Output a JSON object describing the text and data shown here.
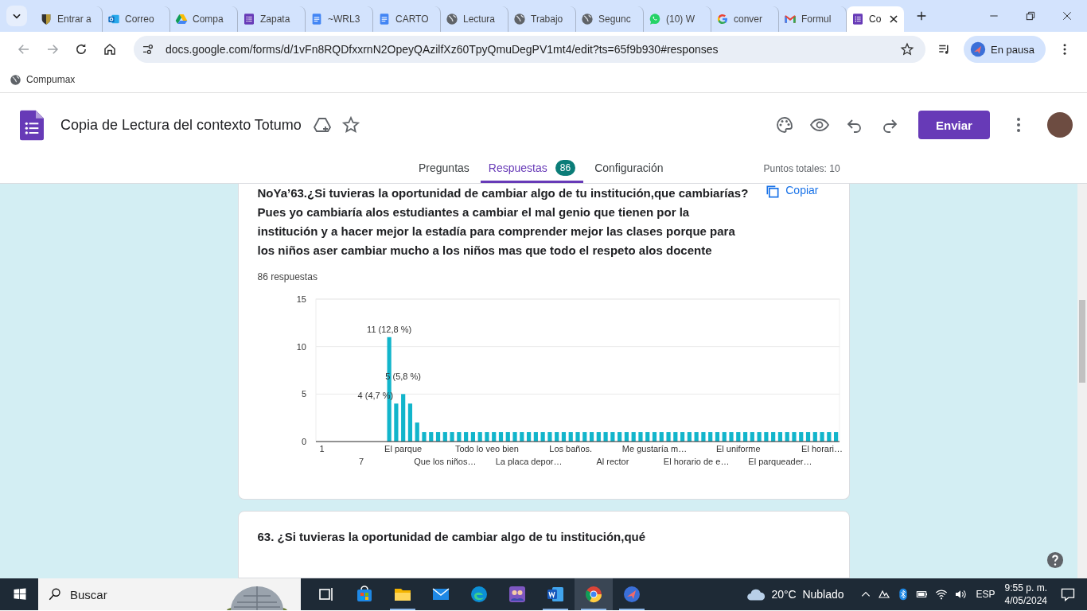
{
  "browser": {
    "tabs": [
      {
        "title": "Entrar a",
        "kind": "shield",
        "selected": false
      },
      {
        "title": "Correo",
        "kind": "outlook",
        "selected": false
      },
      {
        "title": "Compa",
        "kind": "drive",
        "selected": false
      },
      {
        "title": "Zapata",
        "kind": "forms",
        "selected": false
      },
      {
        "title": "~WRL3",
        "kind": "docs",
        "selected": false
      },
      {
        "title": "CARTO",
        "kind": "docs",
        "selected": false
      },
      {
        "title": "Lectura",
        "kind": "globe",
        "selected": false
      },
      {
        "title": "Trabajo",
        "kind": "globe",
        "selected": false
      },
      {
        "title": "Segunc",
        "kind": "globe",
        "selected": false
      },
      {
        "title": "(10) W",
        "kind": "whatsapp",
        "selected": false
      },
      {
        "title": "conver",
        "kind": "google",
        "selected": false
      },
      {
        "title": "Formul",
        "kind": "gmail",
        "selected": false
      },
      {
        "title": "Co",
        "kind": "forms",
        "selected": true
      }
    ],
    "address": "docs.google.com/forms/d/1vFn8RQDfxxrnN2OpeyQAzilfXz60TpyQmuDegPV1mt4/edit?ts=65f9b930#responses",
    "profile": "En pausa",
    "bookmarks": [
      "Compumax"
    ]
  },
  "form": {
    "title": "Copia de Lectura del contexto Totumo",
    "send_button": "Enviar",
    "tabs": [
      {
        "label": "Preguntas",
        "selected": false
      },
      {
        "label": "Respuestas",
        "badge": "86",
        "selected": true
      },
      {
        "label": "Configuración",
        "selected": false
      }
    ],
    "points": "Puntos totales: 10"
  },
  "questions": [
    {
      "text": "NoYa’63.¿Si tuvieras la oportunidad de cambiar algo de tu institución,que cambiarías? Pues yo cambiaría alos estudiantes a cambiar el mal genio que tienen por la institución y a hacer mejor la estadía para comprender mejor las clases porque para los niños aser cambiar mucho a los niños mas que todo el respeto alos docente",
      "copy_button": "Copiar",
      "response_count": "86 respuestas",
      "chart_data": {
        "type": "bar",
        "ylim": [
          0,
          15
        ],
        "yticks": [
          0,
          5,
          10,
          15
        ],
        "values": [
          0,
          0,
          0,
          0,
          0,
          0,
          0,
          0,
          0,
          0,
          11,
          4,
          5,
          4,
          2,
          1,
          1,
          1,
          1,
          1,
          1,
          1,
          1,
          1,
          1,
          1,
          1,
          1,
          1,
          1,
          1,
          1,
          1,
          1,
          1,
          1,
          1,
          1,
          1,
          1,
          1,
          1,
          1,
          1,
          1,
          1,
          1,
          1,
          1,
          1,
          1,
          1,
          1,
          1,
          1,
          1,
          1,
          1,
          1,
          1,
          1,
          1,
          1,
          1,
          1,
          1,
          1,
          1,
          1,
          1,
          1,
          1,
          1,
          1,
          1
        ],
        "categories": [
          "1",
          null,
          null,
          null,
          null,
          null,
          "7",
          null,
          null,
          null,
          null,
          null,
          "El parque",
          null,
          null,
          null,
          null,
          null,
          "Que los niños…",
          null,
          null,
          null,
          null,
          null,
          "Todo lo veo bien",
          null,
          null,
          null,
          null,
          null,
          "La placa depor…",
          null,
          null,
          null,
          null,
          null,
          "Los baños.",
          null,
          null,
          null,
          null,
          null,
          "Al rector",
          null,
          null,
          null,
          null,
          null,
          "Me gustaría m…",
          null,
          null,
          null,
          null,
          null,
          "El horario de e…",
          null,
          null,
          null,
          null,
          null,
          "El uniforme",
          null,
          null,
          null,
          null,
          null,
          "El parqueader…",
          null,
          null,
          null,
          null,
          null,
          "El horari…",
          null,
          null
        ],
        "annotations": [
          "11 (12,8 %)",
          "5 (5,8 %)",
          "4 (4,7 %)"
        ]
      }
    },
    {
      "text": "63. ¿Si tuvieras la oportunidad de cambiar algo de tu institución,qué"
    }
  ],
  "taskbar": {
    "search_placeholder": "Buscar",
    "apps": [
      {
        "kind": "taskview",
        "running": false,
        "selected": false
      },
      {
        "kind": "store",
        "running": false,
        "selected": false
      },
      {
        "kind": "explorer",
        "running": true,
        "selected": false
      },
      {
        "kind": "mail",
        "running": false,
        "selected": false
      },
      {
        "kind": "edge",
        "running": false,
        "selected": false
      },
      {
        "kind": "people",
        "running": false,
        "selected": false
      },
      {
        "kind": "word",
        "running": true,
        "selected": false
      },
      {
        "kind": "chrome",
        "running": true,
        "selected": true
      },
      {
        "kind": "bird",
        "running": true,
        "selected": false
      }
    ],
    "weather": "20°C  Nublado",
    "language": "ESP",
    "time": "9:55 p. m.",
    "date": "4/05/2024"
  }
}
